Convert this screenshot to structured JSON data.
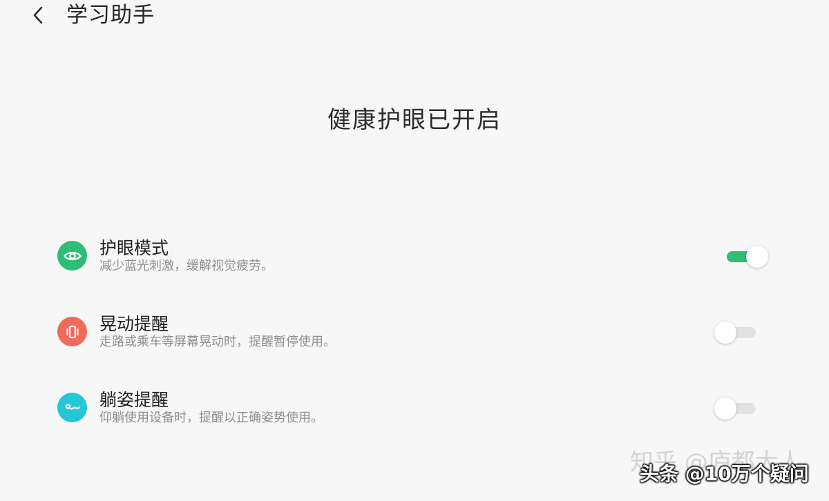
{
  "header": {
    "title": "学习助手",
    "back_icon": "chevron-left-icon"
  },
  "status": {
    "title": "健康护眼已开启"
  },
  "settings": [
    {
      "title": "护眼模式",
      "description": "减少蓝光刺激，缓解视觉疲劳。",
      "icon": "eye-icon",
      "icon_color": "#2dbd75",
      "enabled": true
    },
    {
      "title": "晃动提醒",
      "description": "走路或乘车等屏幕晃动时，提醒暂停使用。",
      "icon": "phone-shake-icon",
      "icon_color": "#ef6b5b",
      "enabled": false
    },
    {
      "title": "躺姿提醒",
      "description": "仰躺使用设备时，提醒以正确姿势使用。",
      "icon": "lying-posture-icon",
      "icon_color": "#23c7d8",
      "enabled": false
    }
  ],
  "colors": {
    "accent": "#2fbe73",
    "background": "#f7f7f7",
    "toggle_off": "#e2e2e2"
  },
  "watermark": {
    "back_text": "知乎 @庐都大人",
    "front_text": "头条 @10万个疑问"
  }
}
